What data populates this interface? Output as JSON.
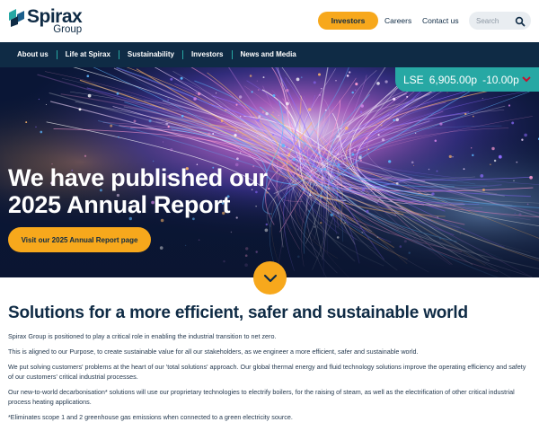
{
  "header": {
    "logo": {
      "word": "Spirax",
      "sub": "Group"
    },
    "investors_button": "Investors",
    "links": [
      {
        "label": "Careers"
      },
      {
        "label": "Contact us"
      }
    ],
    "search": {
      "placeholder": "Search"
    }
  },
  "nav": {
    "items": [
      {
        "label": "About us"
      },
      {
        "label": "Life at Spirax"
      },
      {
        "label": "Sustainability"
      },
      {
        "label": "Investors"
      },
      {
        "label": "News and Media"
      }
    ]
  },
  "share_price": {
    "exchange": "LSE",
    "price": "6,905.00p",
    "change": "-10.00p",
    "trend_icon": "chevron-down-icon"
  },
  "hero": {
    "title_line1": "We have published our",
    "title_line2": "2025 Annual Report",
    "cta": "Visit our 2025 Annual Report page",
    "scroll_icon": "chevron-down-icon"
  },
  "intro": {
    "title": "Solutions for a more efficient, safer and sustainable world",
    "paragraphs": [
      "Spirax Group is positioned to play a critical role in enabling the industrial transition to net zero.",
      "This is aligned to our Purpose, to create sustainable value for all our stakeholders, as we engineer a more efficient, safer and sustainable world.",
      "We put solving customers' problems at the heart of our 'total solutions' approach. Our global thermal energy and fluid technology solutions improve the operating efficiency and safety of our customers' critical industrial processes.",
      "Our new-to-world decarbonisation* solutions will use our proprietary technologies to electrify boilers, for the raising of steam, as well as the electrification of other critical industrial process heating applications.",
      "*Eliminates scope 1 and 2 greenhouse gas emissions when connected to a green electricity source."
    ]
  },
  "colors": {
    "navy": "#0f2b45",
    "accent_orange": "#f7a81c",
    "teal": "#27a8a4",
    "negative_red": "#c8102e"
  }
}
